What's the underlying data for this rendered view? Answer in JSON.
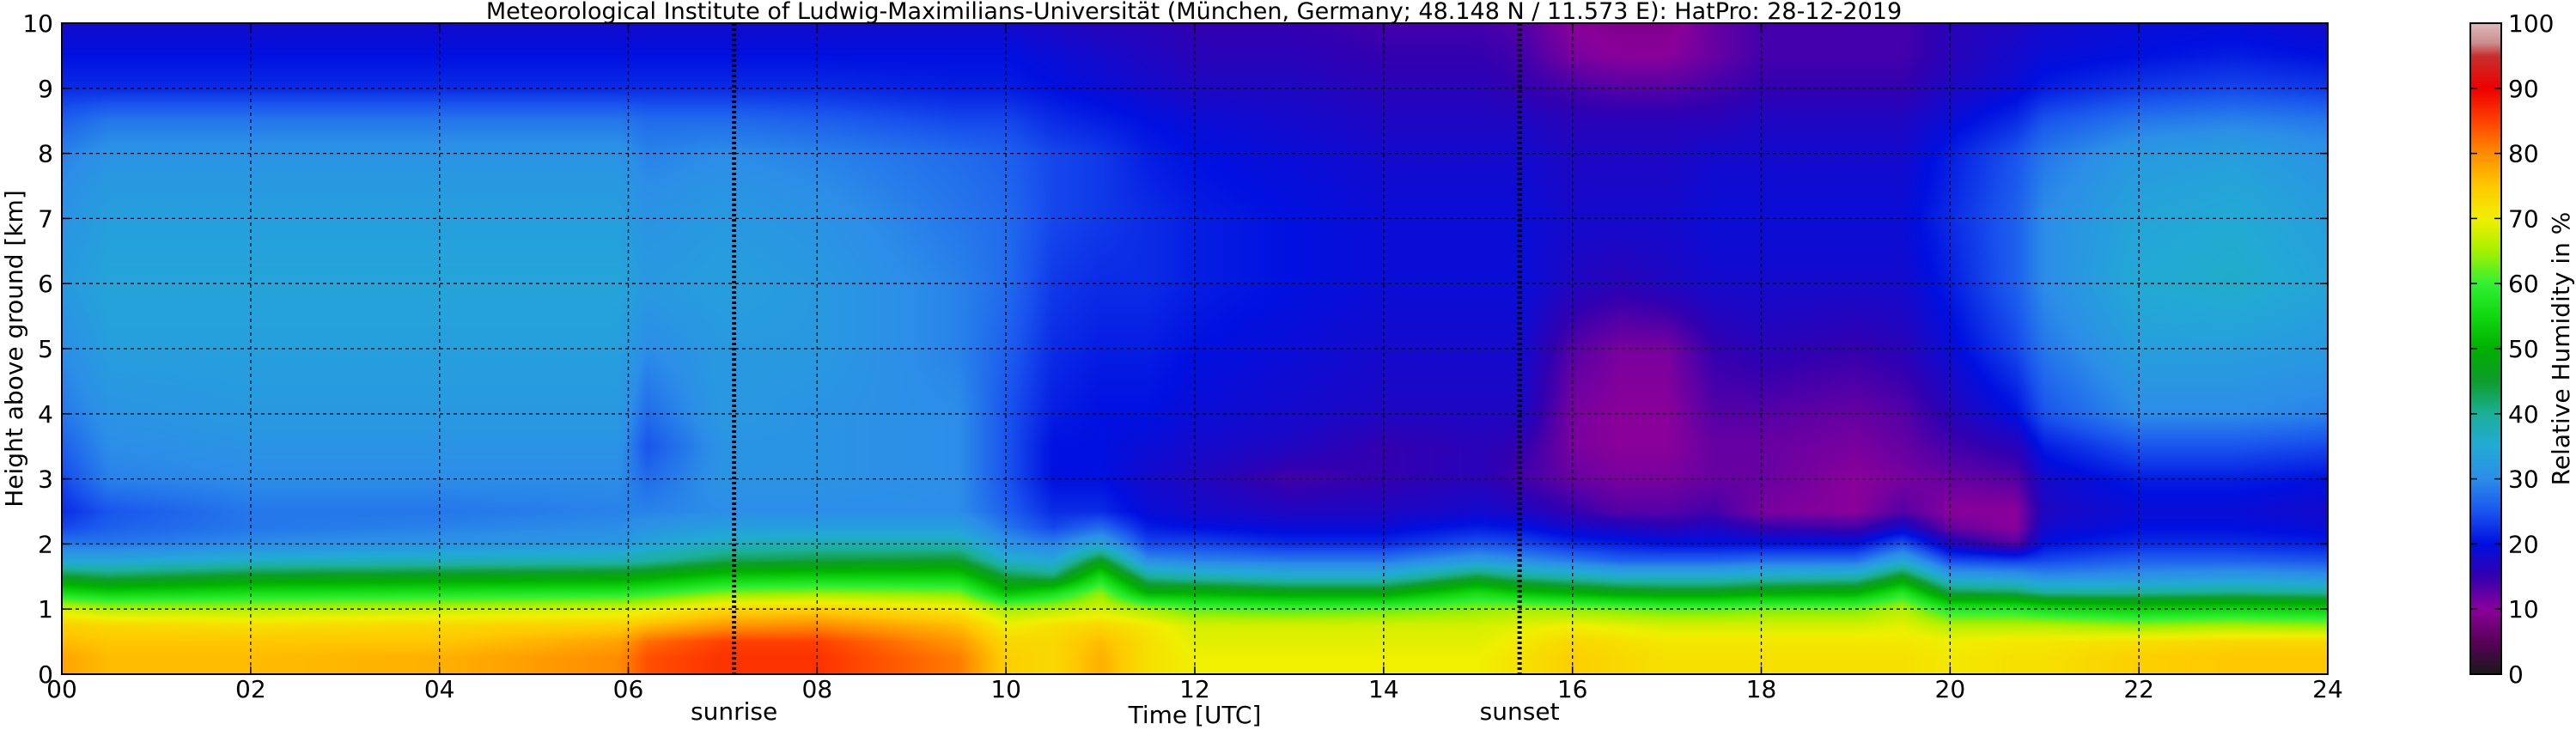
{
  "chart_data": {
    "type": "heatmap",
    "title": "Meteorological Institute of Ludwig-Maximilians-Universität (München, Germany; 48.148 N / 11.573 E):    HatPro: 28-12-2019",
    "xlabel": "Time [UTC]",
    "ylabel": "Height above ground [km]",
    "colorbar_label": "Relative Humidity in %",
    "xlim": [
      0,
      24
    ],
    "ylim": [
      0,
      10
    ],
    "clim": [
      0,
      100
    ],
    "grid": true,
    "x_ticks": [
      "00",
      "02",
      "04",
      "06",
      "08",
      "10",
      "12",
      "14",
      "16",
      "18",
      "20",
      "22",
      "24"
    ],
    "y_ticks": [
      "0",
      "1",
      "2",
      "3",
      "4",
      "5",
      "6",
      "7",
      "8",
      "9",
      "10"
    ],
    "colorbar_ticks": [
      "0",
      "10",
      "20",
      "30",
      "40",
      "50",
      "60",
      "70",
      "80",
      "90",
      "100"
    ],
    "colormap": [
      {
        "value": 0,
        "color": "#1a1a1a"
      },
      {
        "value": 5,
        "color": "#5a005a"
      },
      {
        "value": 10,
        "color": "#8a009a"
      },
      {
        "value": 15,
        "color": "#3300b0"
      },
      {
        "value": 20,
        "color": "#0010e0"
      },
      {
        "value": 25,
        "color": "#1a55ee"
      },
      {
        "value": 30,
        "color": "#2c8ee8"
      },
      {
        "value": 35,
        "color": "#22aad5"
      },
      {
        "value": 40,
        "color": "#1cb09a"
      },
      {
        "value": 45,
        "color": "#0e9c2a"
      },
      {
        "value": 50,
        "color": "#00b000"
      },
      {
        "value": 55,
        "color": "#10d810"
      },
      {
        "value": 60,
        "color": "#33f033"
      },
      {
        "value": 65,
        "color": "#a6f000"
      },
      {
        "value": 70,
        "color": "#f0f000"
      },
      {
        "value": 75,
        "color": "#ffc800"
      },
      {
        "value": 80,
        "color": "#ff8c00"
      },
      {
        "value": 85,
        "color": "#ff4000"
      },
      {
        "value": 90,
        "color": "#ee0000"
      },
      {
        "value": 95,
        "color": "#c83030"
      },
      {
        "value": 97,
        "color": "#cc8f8f"
      },
      {
        "value": 100,
        "color": "#ddbaba"
      }
    ],
    "time_nodes": [
      0,
      0.5,
      2,
      4,
      5.9,
      6.2,
      7,
      8,
      9.5,
      10,
      10.5,
      11,
      11.5,
      12,
      13,
      14,
      15,
      15.5,
      16,
      16.5,
      17,
      17.5,
      18,
      19,
      19.5,
      20,
      20.7,
      21,
      22,
      23,
      24
    ],
    "height_nodes": [
      0,
      0.25,
      0.5,
      0.75,
      1,
      1.25,
      1.5,
      1.75,
      2,
      2.25,
      2.5,
      3,
      3.5,
      4,
      5,
      6,
      7,
      8,
      8.5,
      9,
      9.5,
      10
    ],
    "rh_percent": [
      [
        78,
        78,
        76,
        74,
        68,
        56,
        45,
        34,
        28,
        24,
        22,
        24,
        26,
        28,
        30,
        32,
        31,
        29,
        26,
        22,
        20,
        18
      ],
      [
        76,
        76,
        75,
        73,
        66,
        54,
        43,
        34,
        28,
        26,
        25,
        29,
        30,
        31,
        33,
        34,
        33,
        31,
        28,
        22,
        20,
        18
      ],
      [
        76,
        76,
        75,
        72,
        66,
        56,
        46,
        36,
        30,
        28,
        28,
        30,
        31,
        32,
        33,
        34,
        33,
        31,
        28,
        22,
        20,
        18
      ],
      [
        77,
        77,
        75,
        73,
        67,
        57,
        47,
        37,
        31,
        29,
        28,
        30,
        31,
        32,
        33,
        34,
        33,
        31,
        28,
        22,
        20,
        18
      ],
      [
        80,
        80,
        78,
        74,
        68,
        58,
        48,
        38,
        32,
        30,
        29,
        30,
        31,
        32,
        33,
        34,
        33,
        31,
        28,
        22,
        20,
        18
      ],
      [
        84,
        84,
        82,
        76,
        69,
        59,
        49,
        39,
        34,
        31,
        29,
        27,
        25,
        27,
        30,
        32,
        31,
        29,
        27,
        22,
        20,
        18
      ],
      [
        86,
        86,
        85,
        79,
        73,
        63,
        53,
        43,
        37,
        33,
        30,
        31,
        31,
        32,
        32,
        33,
        32,
        30,
        27,
        22,
        20,
        18
      ],
      [
        86,
        86,
        85,
        80,
        74,
        64,
        54,
        44,
        38,
        33,
        30,
        31,
        31,
        31,
        32,
        32,
        31,
        29,
        26,
        22,
        20,
        18
      ],
      [
        81,
        81,
        79,
        76,
        71,
        63,
        54,
        45,
        38,
        33,
        30,
        30,
        30,
        30,
        29,
        29,
        28,
        27,
        24,
        21,
        20,
        18
      ],
      [
        74,
        74,
        73,
        70,
        65,
        52,
        44,
        36,
        31,
        28,
        26,
        25,
        25,
        25,
        26,
        27,
        27,
        26,
        24,
        21,
        20,
        18
      ],
      [
        73,
        73,
        73,
        72,
        66,
        56,
        42,
        34,
        29,
        24,
        22,
        20,
        20,
        21,
        22,
        23,
        24,
        24,
        22,
        20,
        19,
        17
      ],
      [
        77,
        77,
        76,
        73,
        68,
        64,
        56,
        46,
        34,
        27,
        22,
        20,
        20,
        20,
        21,
        22,
        23,
        23,
        21,
        19,
        18,
        16
      ],
      [
        72,
        72,
        72,
        71,
        65,
        50,
        40,
        30,
        24,
        21,
        19,
        18,
        19,
        20,
        21,
        22,
        22,
        21,
        20,
        18,
        17,
        16
      ],
      [
        70,
        70,
        69,
        68,
        62,
        50,
        38,
        29,
        24,
        20,
        18,
        17,
        18,
        19,
        20,
        21,
        21,
        20,
        19,
        17,
        16,
        15
      ],
      [
        70,
        70,
        69,
        68,
        61,
        48,
        36,
        28,
        22,
        19,
        17,
        14,
        17,
        18,
        19,
        20,
        20,
        19,
        18,
        17,
        16,
        15
      ],
      [
        70,
        70,
        69,
        68,
        62,
        48,
        36,
        28,
        22,
        19,
        17,
        15,
        15,
        17,
        18,
        19,
        19,
        18,
        17,
        16,
        15,
        14
      ],
      [
        70,
        70,
        69,
        68,
        64,
        56,
        44,
        32,
        25,
        21,
        18,
        16,
        16,
        17,
        18,
        19,
        19,
        18,
        17,
        16,
        15,
        14
      ],
      [
        72,
        72,
        71,
        69,
        65,
        52,
        40,
        30,
        24,
        20,
        17,
        14,
        15,
        17,
        18,
        19,
        19,
        18,
        17,
        15,
        14,
        13
      ],
      [
        74,
        74,
        73,
        70,
        64,
        50,
        38,
        28,
        22,
        18,
        15,
        12,
        11,
        11,
        13,
        17,
        18,
        17,
        16,
        14,
        11,
        10
      ],
      [
        73,
        73,
        72,
        69,
        63,
        48,
        36,
        26,
        21,
        17,
        13,
        11,
        10,
        10,
        11,
        16,
        18,
        17,
        16,
        13,
        10,
        9
      ],
      [
        72,
        72,
        71,
        68,
        62,
        47,
        36,
        26,
        20,
        16,
        13,
        11,
        10,
        10,
        11,
        17,
        18,
        17,
        16,
        13,
        10,
        9
      ],
      [
        72,
        72,
        71,
        68,
        62,
        47,
        36,
        26,
        20,
        17,
        14,
        12,
        12,
        13,
        15,
        18,
        19,
        18,
        16,
        14,
        12,
        12
      ],
      [
        72,
        72,
        71,
        68,
        63,
        49,
        37,
        27,
        20,
        15,
        11,
        12,
        12,
        13,
        16,
        18,
        19,
        18,
        17,
        15,
        14,
        14
      ],
      [
        72,
        72,
        71,
        68,
        63,
        50,
        38,
        27,
        20,
        14,
        10,
        10,
        11,
        12,
        15,
        18,
        19,
        18,
        17,
        15,
        14,
        14
      ],
      [
        72,
        72,
        71,
        69,
        66,
        58,
        46,
        34,
        25,
        18,
        13,
        11,
        12,
        13,
        16,
        18,
        19,
        18,
        17,
        15,
        14,
        14
      ],
      [
        71,
        71,
        70,
        66,
        58,
        44,
        33,
        24,
        17,
        12,
        10,
        12,
        14,
        16,
        19,
        21,
        22,
        21,
        19,
        17,
        16,
        16
      ],
      [
        72,
        72,
        71,
        66,
        58,
        43,
        32,
        23,
        13,
        10,
        10,
        13,
        16,
        20,
        24,
        26,
        26,
        25,
        22,
        19,
        18,
        17
      ],
      [
        72,
        72,
        71,
        66,
        56,
        40,
        30,
        24,
        20,
        18,
        17,
        18,
        21,
        25,
        28,
        30,
        30,
        28,
        25,
        21,
        19,
        18
      ],
      [
        74,
        74,
        72,
        64,
        54,
        40,
        31,
        26,
        22,
        20,
        19,
        21,
        25,
        30,
        33,
        35,
        34,
        32,
        28,
        23,
        20,
        19
      ],
      [
        75,
        75,
        73,
        65,
        55,
        41,
        32,
        26,
        22,
        20,
        19,
        21,
        25,
        30,
        33,
        36,
        35,
        33,
        29,
        24,
        21,
        19
      ],
      [
        75,
        75,
        73,
        64,
        54,
        40,
        31,
        25,
        21,
        19,
        18,
        20,
        24,
        29,
        32,
        34,
        33,
        31,
        28,
        23,
        20,
        18
      ]
    ],
    "annotations": [
      {
        "text": "sunrise",
        "x": 7.12
      },
      {
        "text": "sunset",
        "x": 15.44
      }
    ]
  }
}
